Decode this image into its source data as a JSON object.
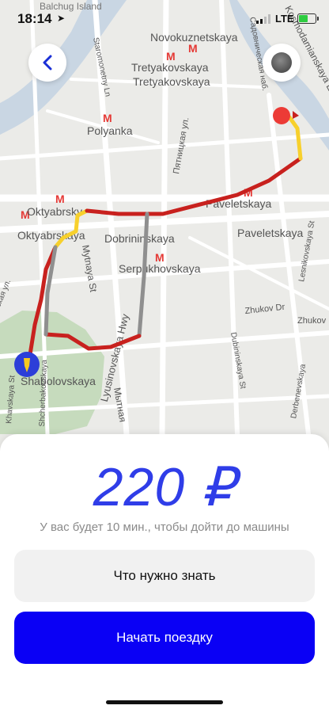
{
  "status_bar": {
    "time": "18:14",
    "network": "LTE",
    "battery_color": "#2ecc40"
  },
  "map": {
    "labels": [
      "Balchug Island",
      "Novokuznetskaya",
      "Tretyakovskaya",
      "Tretyakovskaya",
      "Polyanka",
      "Staromonetny Ln",
      "Пятницкая ул.",
      "Oktyabrsky",
      "Oktyabrskaya",
      "Dobrininskaya",
      "Paveletskaya",
      "Paveletskaya",
      "Serpukhovskaya",
      "Mytnaya St",
      "Мытная",
      "Zhukov Dr",
      "Zhukov",
      "Lesnikovskaya St",
      "Dubininskaya St",
      "Khavskaya St",
      "Донская ул.",
      "Shabolovskaya",
      "Lyusinovskaya Hwy",
      "Shcherbakovskaya",
      "Садовническая наб.",
      "Kosmodamianskaya Embankment",
      "Derbenevskaya"
    ],
    "metro_color": "#e53935",
    "route_colors": {
      "slow": "#c8211e",
      "medium": "#f7d02c",
      "fast": "#8f8f8f"
    }
  },
  "nav": {
    "back_label": "Back"
  },
  "trip": {
    "price": "220 ₽",
    "walk_info": "У вас будет 10 мин., чтобы дойти до машины",
    "info_button": "Что нужно знать",
    "start_button": "Начать поездку",
    "accent_color": "#0a00f5"
  }
}
